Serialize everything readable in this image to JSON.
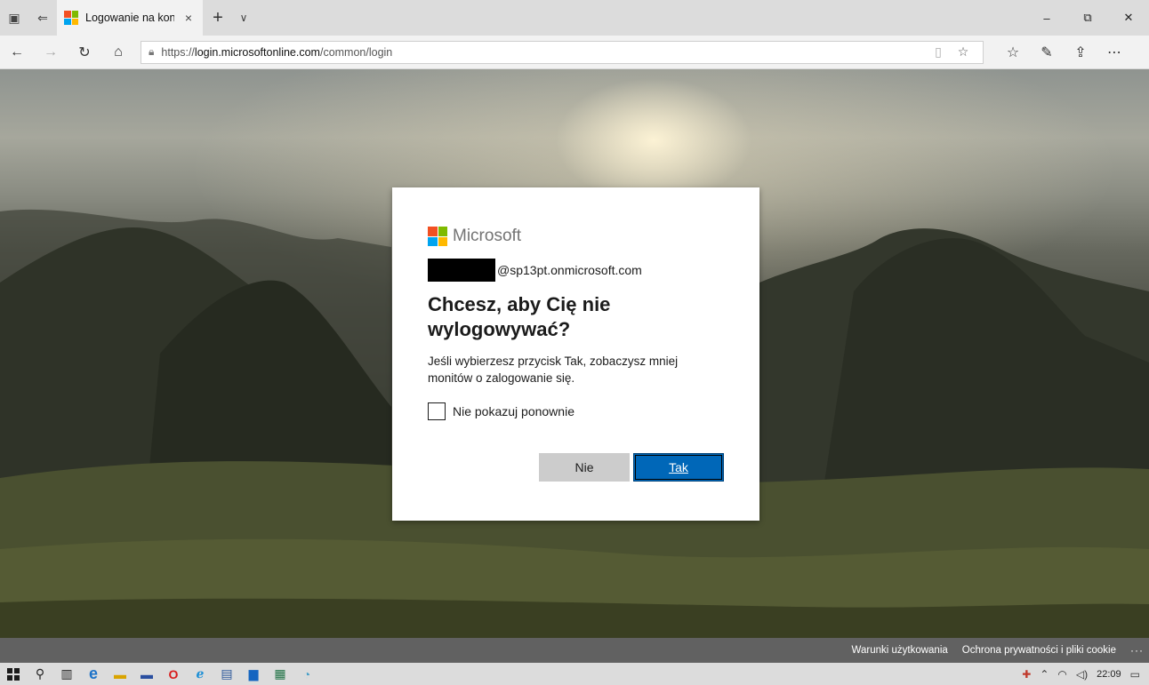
{
  "browser": {
    "tab": {
      "title": "Logowanie na koncie",
      "close": "×"
    },
    "new_tab": "+",
    "tab_menu": "∨",
    "window": {
      "minimize": "–",
      "restore": "⧉",
      "close": "✕"
    },
    "address": {
      "url_prefix": "https://",
      "url_host": "login.microsoftonline.com",
      "url_path": "/common/login"
    }
  },
  "dialog": {
    "brand": "Microsoft",
    "identity_suffix": "@sp13pt.onmicrosoft.com",
    "heading": "Chcesz, aby Cię nie wylogowywać?",
    "description": "Jeśli wybierzesz przycisk Tak, zobaczysz mniej monitów o zalogowanie się.",
    "checkbox_label": "Nie pokazuj ponownie",
    "no_label": "Nie",
    "yes_label": "Tak"
  },
  "footer": {
    "terms": "Warunki użytkowania",
    "privacy": "Ochrona prywatności i pliki cookie",
    "more": "···"
  },
  "taskbar": {
    "clock": "22:09"
  },
  "colors": {
    "ms_red": "#f25022",
    "ms_green": "#7fba00",
    "ms_blue": "#00a4ef",
    "ms_yellow": "#ffb900",
    "primary_button": "#0067b8"
  }
}
